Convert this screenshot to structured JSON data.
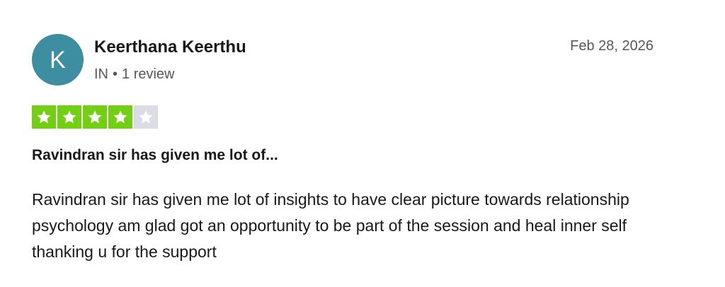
{
  "reviewer": {
    "initial": "K",
    "name": "Keerthana Keerthu",
    "country": "IN",
    "separator": "•",
    "review_count": "1 review",
    "avatar_color": "#3c8ea0"
  },
  "review": {
    "date": "Feb 28, 2026",
    "rating": 4,
    "max_rating": 5,
    "filled_star_color": "#73cf11",
    "empty_star_color": "#dcdce6",
    "star_icon": "star-icon",
    "title": "Ravindran sir has given me lot of...",
    "body": "Ravindran sir has given me lot of insights to have clear picture towards relationship psychology am glad got an opportunity to be part of the session and heal inner self thanking u for the support"
  }
}
